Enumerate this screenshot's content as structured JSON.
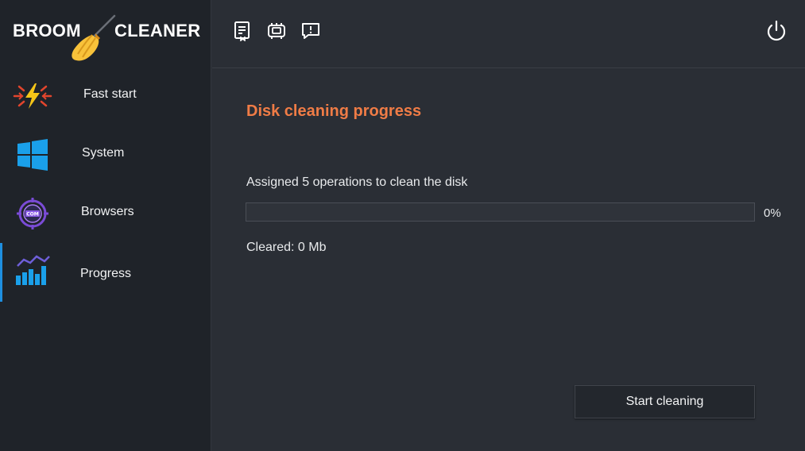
{
  "app": {
    "logo_left": "BROOM",
    "logo_right": "CLEANER",
    "logo_icon": "broom-icon",
    "accent_color": "#f07c46",
    "highlight_color": "#1e8fe0"
  },
  "sidebar": {
    "items": [
      {
        "label": "Fast start",
        "icon": "lightning-icon"
      },
      {
        "label": "System",
        "icon": "windows-icon"
      },
      {
        "label": "Browsers",
        "icon": "com-target-icon"
      },
      {
        "label": "Progress",
        "icon": "chart-icon",
        "active": true
      }
    ]
  },
  "toolbar": {
    "icons": [
      "report-icon",
      "hardware-icon",
      "feedback-icon"
    ],
    "power_icon": "power-icon"
  },
  "main": {
    "title": "Disk cleaning progress",
    "assigned_text": "Assigned 5 operations to clean the disk",
    "progress": {
      "value_percent": 0,
      "label": "0%"
    },
    "cleared_text": "Cleared: 0 Mb",
    "start_button": "Start cleaning"
  }
}
